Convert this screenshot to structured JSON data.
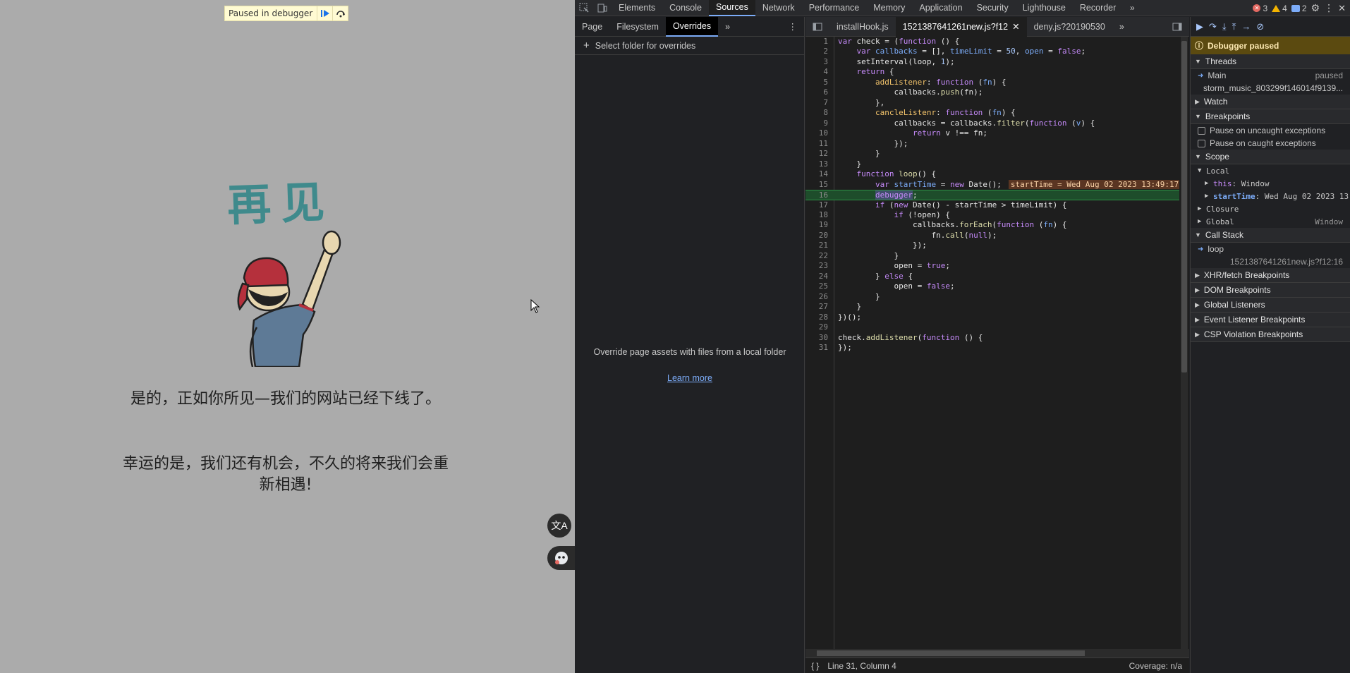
{
  "page": {
    "paused_label": "Paused in debugger",
    "title": "再见",
    "message1": "是的，正如你所见—我们的网站已经下线了。",
    "message2": "幸运的是，我们还有机会，不久的将来我们会重新相遇!"
  },
  "devtools": {
    "main_tabs": [
      "Elements",
      "Console",
      "Sources",
      "Network",
      "Performance",
      "Memory",
      "Application",
      "Security",
      "Lighthouse",
      "Recorder"
    ],
    "active_tab": "Sources",
    "errors": "3",
    "warnings": "4",
    "messages": "2",
    "navigator": {
      "tabs": [
        "Page",
        "Filesystem",
        "Overrides"
      ],
      "active": "Overrides",
      "add_folder": "Select folder for overrides",
      "empty_text": "Override page assets with files from a local folder",
      "learn_more": "Learn more"
    },
    "editor": {
      "tabs": [
        "installHook.js",
        "1521387641261new.js?f12",
        "deny.js?20190530"
      ],
      "active": "1521387641261new.js?f12",
      "status_position": "Line 31, Column 4",
      "status_coverage": "Coverage: n/a",
      "inline_value": "startTime = Wed Aug 02 2023 13:49:17"
    },
    "sidebar": {
      "paused": "Debugger paused",
      "threads": "Threads",
      "thread_main": "Main",
      "thread_main_status": "paused",
      "thread_worker": "storm_music_803299f146014f9139...",
      "watch": "Watch",
      "breakpoints": "Breakpoints",
      "pause_uncaught": "Pause on uncaught exceptions",
      "pause_caught": "Pause on caught exceptions",
      "scope": "Scope",
      "local": "Local",
      "this_key": "this",
      "this_val": "Window",
      "start_key": "startTime",
      "start_val": "Wed Aug 02 2023 13:...",
      "closure": "Closure",
      "global": "Global",
      "global_val": "Window",
      "call_stack": "Call Stack",
      "frame_name": "loop",
      "frame_loc": "1521387641261new.js?f12:16",
      "xhr": "XHR/fetch Breakpoints",
      "dom": "DOM Breakpoints",
      "global_listeners": "Global Listeners",
      "event_listener": "Event Listener Breakpoints",
      "csp": "CSP Violation Breakpoints"
    }
  }
}
